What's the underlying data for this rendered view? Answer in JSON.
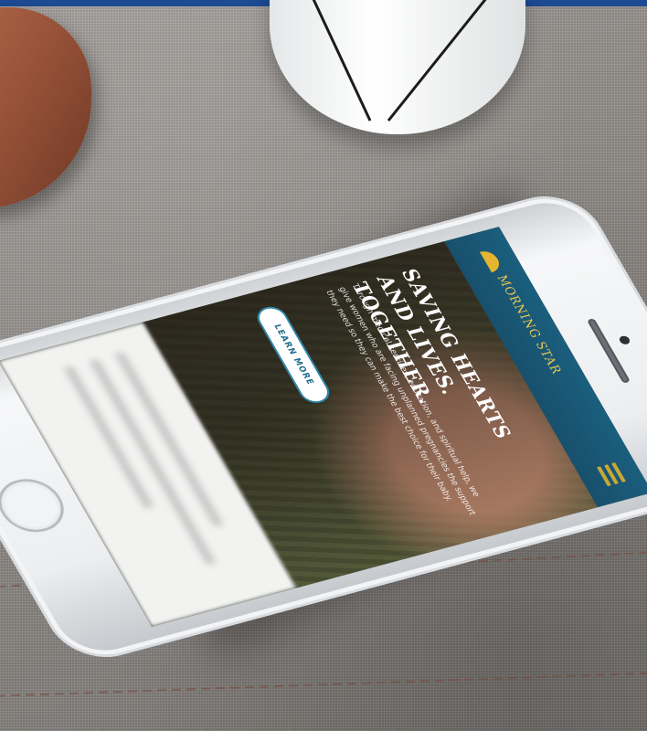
{
  "website": {
    "logo_text": "MORNING STAR",
    "hero": {
      "title": "SAVING HEARTS AND LIVES. TOGETHER.",
      "body": "Through medical services, education, and spiritual help, we give women who are facing unplanned pregnancies the support they need so they can make the best choice for their baby.",
      "button_label": "LEARN MORE"
    }
  },
  "colors": {
    "header_blue": "#1b5e7e",
    "logo_gold": "#e8c653",
    "button_border": "#2f86a8",
    "top_band": "#1d4a93"
  },
  "icons": [
    "logo-sun-icon",
    "menu-icon"
  ]
}
